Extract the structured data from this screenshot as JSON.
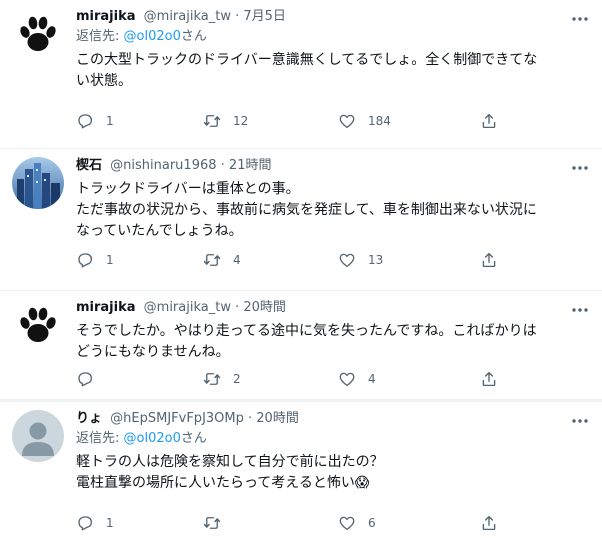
{
  "tweets": [
    {
      "name": "mirajika",
      "handle": "@mirajika_tw",
      "time": "7月5日",
      "replying_prefix": "返信先: ",
      "replying_handle": "@ol02o0",
      "replying_suffix": "さん",
      "text": "この大型トラックのドライバー意識無くしてるでしょ。全く制御できてな\nい状態。",
      "reply_count": "1",
      "retweet_count": "12",
      "like_count": "184",
      "avatar": "paw-icon"
    },
    {
      "name": "楔石",
      "handle": "@nishinaru1968",
      "time": "21時間",
      "text": "トラックドライバーは重体との事。\nただ事故の状況から、事故前に病気を発症して、車を制御出来ない状況に\nなっていたんでしょうね。",
      "reply_count": "1",
      "retweet_count": "4",
      "like_count": "13",
      "avatar": "cityscape-avatar"
    },
    {
      "name": "mirajika",
      "handle": "@mirajika_tw",
      "time": "20時間",
      "text": "そうでしたか。やはり走ってる途中に気を失ったんですね。こればかりは\nどうにもなりませんね。",
      "reply_count": "",
      "retweet_count": "2",
      "like_count": "4",
      "avatar": "paw-icon"
    },
    {
      "name": "りょ",
      "handle": "@hEpSMJFvFpJ3OMp",
      "time": "20時間",
      "replying_prefix": "返信先: ",
      "replying_handle": "@ol02o0",
      "replying_suffix": "さん",
      "text": "軽トラの人は危険を察知して自分で前に出たの？\n電柱直撃の場所に人いたらって考えると怖い😱",
      "reply_count": "1",
      "retweet_count": "",
      "like_count": "6",
      "avatar": "default-avatar"
    }
  ],
  "separator": " · ",
  "colors": {
    "text": "#0f1419",
    "secondary": "#536471",
    "link": "#1d9bf0",
    "border": "#eff3f4"
  }
}
